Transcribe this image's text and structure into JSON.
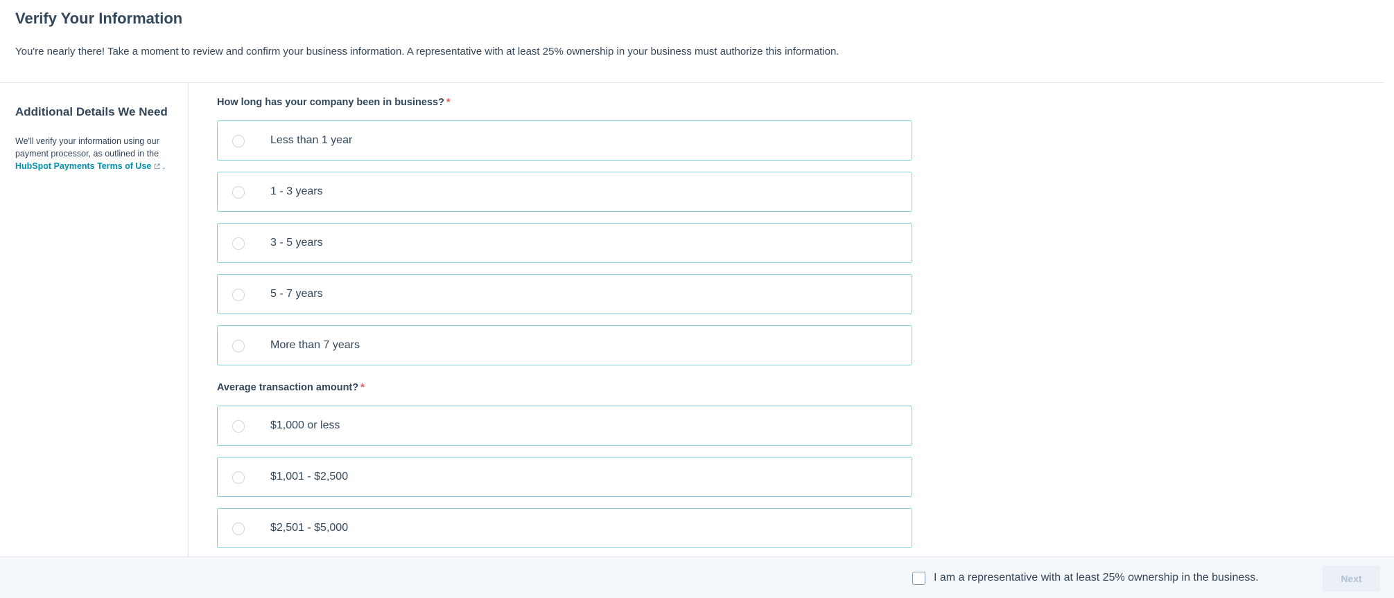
{
  "header": {
    "title": "Verify Your Information",
    "intro": "You're nearly there! Take a moment to review and confirm your business information. A representative with at least 25% ownership in your business must authorize this information."
  },
  "sidebar": {
    "title": "Additional Details We Need",
    "text_before_link": "We'll verify your information using our payment processor, as outlined in the",
    "link_label": "HubSpot Payments Terms of Use",
    "text_after_link": ".",
    "link_icon": "external-link-icon"
  },
  "questions": {
    "business_length": {
      "label": "How long has your company been in business?",
      "required_marker": "*",
      "options": [
        "Less than 1 year",
        "1 - 3 years",
        "3 - 5 years",
        "5 - 7 years",
        "More than 7 years"
      ]
    },
    "transaction_amount": {
      "label": "Average transaction amount?",
      "required_marker": "*",
      "options": [
        "$1,000 or less",
        "$1,001 - $2,500",
        "$2,501 - $5,000"
      ]
    }
  },
  "footer": {
    "consent_label": "I am a representative with at least 25% ownership in the business.",
    "consent_checked": false,
    "next_label": "Next",
    "next_disabled": true
  },
  "colors": {
    "text": "#33475b",
    "accent_link": "#0091ae",
    "option_border": "#7fd1de",
    "required": "#f2545b",
    "footer_bg": "#f5f8fa",
    "disabled_button_text": "#b0c1d4"
  }
}
